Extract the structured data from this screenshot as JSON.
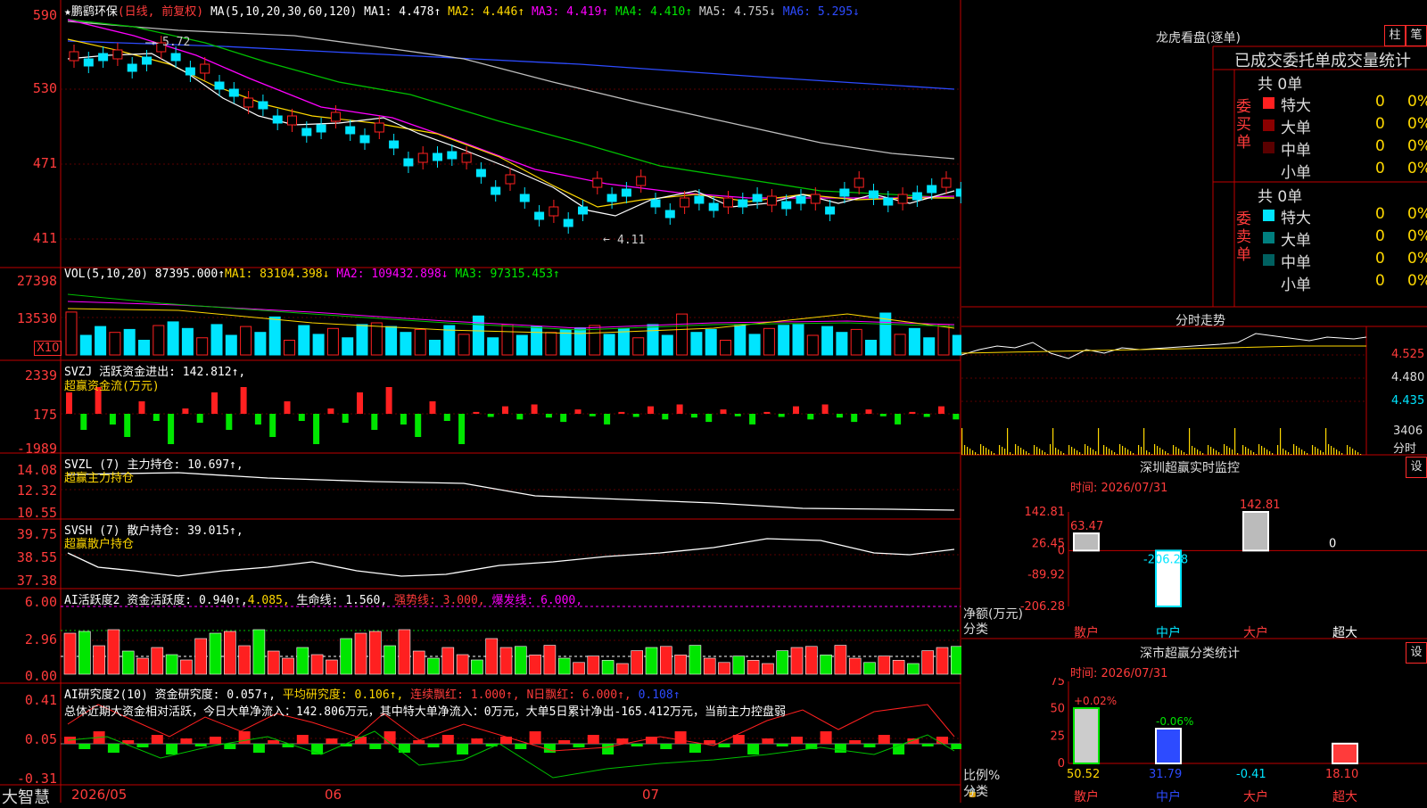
{
  "stock": {
    "name": "★鹏鹞环保",
    "mode": "(日线, 前复权)"
  },
  "price_panel": {
    "ma_label": "MA(5,10,20,30,60,120)",
    "ma": [
      {
        "text": "MA1: 4.478↑",
        "color": "#ffffff"
      },
      {
        "text": "MA2: 4.446↑",
        "color": "#ffd800"
      },
      {
        "text": "MA3: 4.419↑",
        "color": "#ff00ff"
      },
      {
        "text": "MA4: 4.410↑",
        "color": "#00e600"
      },
      {
        "text": "MA5: 4.755↓",
        "color": "#cccccc"
      },
      {
        "text": "MA6: 5.295↓",
        "color": "#2d4bff"
      }
    ],
    "axis": [
      "590",
      "530",
      "471",
      "411"
    ],
    "high_label": "5.72",
    "low_label": "4.11"
  },
  "vol_panel": {
    "label": "VOL(5,10,20)",
    "value": "87395.000↑",
    "ma1": "MA1: 83104.398↓",
    "ma2": "MA2: 109432.898↓",
    "ma3": "MA3: 97315.453↑",
    "axis": [
      "27398",
      "13530"
    ],
    "unit": "X10"
  },
  "svzj": {
    "label": "SVZJ  活跃资金进出: 142.812↑,",
    "sub": "超赢资金流(万元)",
    "axis": [
      "2339",
      "175",
      "-1989"
    ]
  },
  "svzl": {
    "label": "SVZL (7) 主力持仓: 10.697↑,",
    "sub": "超赢主力持仓",
    "axis": [
      "14.08",
      "12.32",
      "10.55"
    ]
  },
  "svsh": {
    "label": "SVSH (7) 散户持仓: 39.015↑,",
    "sub": "超赢散户持仓",
    "axis": [
      "39.75",
      "38.55",
      "37.38"
    ]
  },
  "ai_active": {
    "t1": "AI活跃度2 资金活跃度: 0.940↑,",
    "t2": "4.085,",
    "t3": "生命线: 1.560,",
    "t4": "强势线: 3.000,",
    "t5": "爆发线: 6.000,",
    "axis": [
      "6.00",
      "2.96",
      "0.00"
    ]
  },
  "ai_research": {
    "t1": "AI研究度2(10) 资金研究度: 0.057↑,",
    "t2": "平均研究度: 0.106↑,",
    "t3": "连续飘红: 1.000↑,",
    "t4": "N日飘红: 6.000↑,",
    "t5": "0.108↑",
    "summary": "总体近期大资金相对活跃，今日大单净流入：142.806万元，其中特大单净流入：0万元，大单5日累计净出-165.412万元，当前主力控盘弱",
    "axis": [
      "0.41",
      "0.05",
      "-0.31"
    ]
  },
  "bottom_axis": {
    "app": "大智慧",
    "months": [
      "2026/05",
      "06",
      "07"
    ]
  },
  "dragon": {
    "title": "龙虎看盘(逐单)",
    "btn1": "柱",
    "btn2": "笔",
    "tabs": "已成交委托单成交量统计",
    "buy": {
      "side": "委买单",
      "total": "共 0单",
      "rows": [
        {
          "label": "特大",
          "n": "0",
          "p": "0%",
          "color": "#ff2020"
        },
        {
          "label": "大单",
          "n": "0",
          "p": "0%",
          "color": "#8b0000"
        },
        {
          "label": "中单",
          "n": "0",
          "p": "0%",
          "color": "#5a0000"
        },
        {
          "label": "小单",
          "n": "0",
          "p": "0%",
          "color": ""
        }
      ]
    },
    "sell": {
      "side": "委卖单",
      "total": "共 0单",
      "rows": [
        {
          "label": "特大",
          "n": "0",
          "p": "0%",
          "color": "#00e5ff"
        },
        {
          "label": "大单",
          "n": "0",
          "p": "0%",
          "color": "#007f7f"
        },
        {
          "label": "中单",
          "n": "0",
          "p": "0%",
          "color": "#006060"
        },
        {
          "label": "小单",
          "n": "0",
          "p": "0%",
          "color": ""
        }
      ]
    }
  },
  "intraday": {
    "title": "分时走势",
    "axis": [
      "4.525",
      "4.480",
      "4.435"
    ],
    "vol": "3406",
    "vol_unit": "分时"
  },
  "sz_monitor": {
    "title": "深圳超赢实时监控",
    "set": "设",
    "time": "时间: 2026/07/31",
    "axis": [
      "142.81",
      "26.45",
      "0",
      "-89.92",
      "-206.28"
    ],
    "ylabel": "净额(万元)",
    "xlabel": "分类",
    "chart_data": {
      "type": "bar",
      "categories": [
        "散户",
        "中户",
        "大户",
        "超大"
      ],
      "values": [
        63.47,
        -206.28,
        142.81,
        0
      ],
      "labels": [
        "63.47",
        "-206.28",
        "142.81",
        "0"
      ],
      "ylim": [
        -206.28,
        142.81
      ]
    }
  },
  "sz_stats": {
    "title": "深市超赢分类统计",
    "set": "设",
    "time": "时间: 2026/07/31",
    "axis": [
      "75",
      "50",
      "25",
      "0"
    ],
    "ylabel": "比例%",
    "xlabel": "分类",
    "chart_data": {
      "type": "bar",
      "categories": [
        "散户",
        "中户",
        "大户",
        "超大"
      ],
      "values": [
        50.52,
        31.79,
        -0.41,
        18.1
      ],
      "labels": [
        "50.52",
        "31.79",
        "-0.41",
        "18.10"
      ],
      "changes": [
        "+0.02%",
        "-0.06%",
        "",
        ""
      ],
      "ylim": [
        0,
        75
      ]
    }
  }
}
